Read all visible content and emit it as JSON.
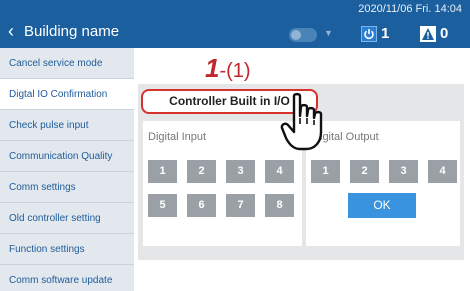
{
  "header": {
    "back_label": "Building name",
    "datetime": "2020/11/06 Fri. 14:04",
    "power_count": "1",
    "warning_count": "0",
    "accent": "#1b5f9e"
  },
  "sidebar": {
    "items": [
      {
        "label": "Cancel service mode"
      },
      {
        "label": "Digtal IO Confirmation"
      },
      {
        "label": "Check pulse input"
      },
      {
        "label": "Communication Quality"
      },
      {
        "label": "Comm settings"
      },
      {
        "label": "Old controller setting"
      },
      {
        "label": "Function settings"
      },
      {
        "label": "Comm software update"
      }
    ]
  },
  "annotation": {
    "step_number": "1",
    "step_suffix": "-(1)",
    "color": "#c0282d"
  },
  "main": {
    "tab_label": "Controller Built in I/O",
    "digital_input": {
      "label": "Digital Input",
      "buttons": [
        "1",
        "2",
        "3",
        "4",
        "5",
        "6",
        "7",
        "8"
      ]
    },
    "digital_output": {
      "label": "igital Output",
      "buttons": [
        "1",
        "2",
        "3",
        "4"
      ],
      "ok_label": "OK"
    }
  }
}
